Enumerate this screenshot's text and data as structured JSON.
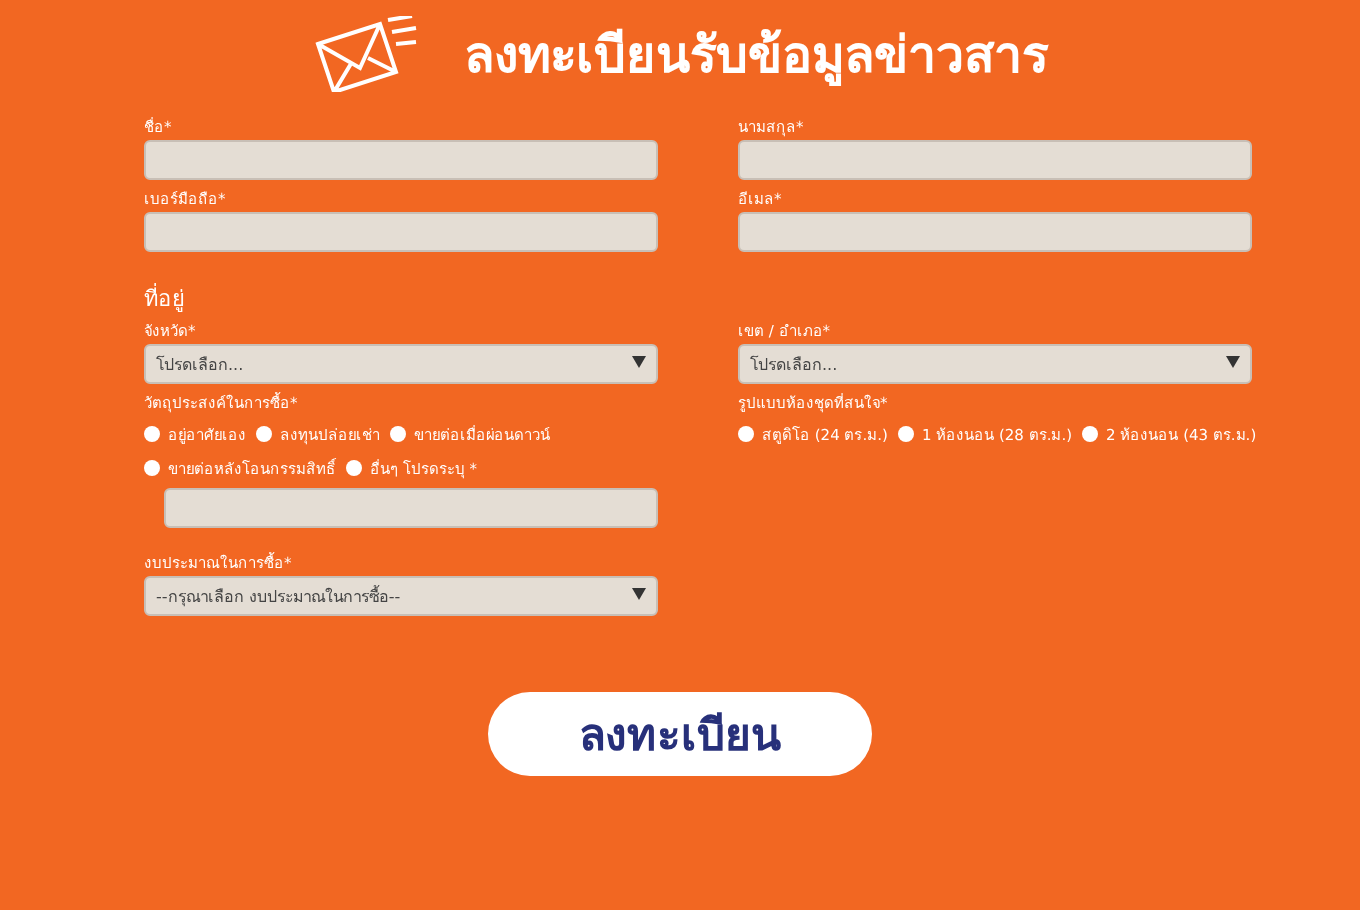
{
  "title": "ลงทะเบียนรับข้อมูลข่าวสาร",
  "fields_top": [
    {
      "label": "ชื่อ*"
    },
    {
      "label": "นามสกุล*"
    },
    {
      "label": "เบอร์มือถือ*"
    },
    {
      "label": "อีเมล*"
    }
  ],
  "address": {
    "heading": "ที่อยู่",
    "province": {
      "label": "จังหวัด*",
      "value": "โปรดเลือก..."
    },
    "district": {
      "label": "เขต / อำเภอ*",
      "value": "โปรดเลือก..."
    }
  },
  "purpose": {
    "label": "วัตถุประสงค์ในการซื้อ*",
    "options": [
      {
        "label": "อยู่อาศัยเอง",
        "selected": false
      },
      {
        "label": "ลงทุนปล่อยเช่า",
        "selected": false
      },
      {
        "label": "ขายต่อเมื่อผ่อนดาวน์",
        "selected": false
      },
      {
        "label": "ขายต่อหลังโอนกรรมสิทธิ์",
        "selected": false
      },
      {
        "label": "อื่นๆ โปรดระบุ *",
        "selected": false
      }
    ]
  },
  "room_type": {
    "label": "รูปแบบห้องชุดที่สนใจ*",
    "options": [
      {
        "label": "สตูดิโอ (24 ตร.ม.)",
        "selected": false
      },
      {
        "label": "1 ห้องนอน (28 ตร.ม.)",
        "selected": false
      },
      {
        "label": "2 ห้องนอน (43 ตร.ม.)",
        "selected": false
      }
    ]
  },
  "budget": {
    "label": "งบประมาณในการซื้อ*",
    "value": "--กรุณาเลือก งบประมาณในการซื้อ--"
  },
  "submit": "ลงทะเบียน"
}
